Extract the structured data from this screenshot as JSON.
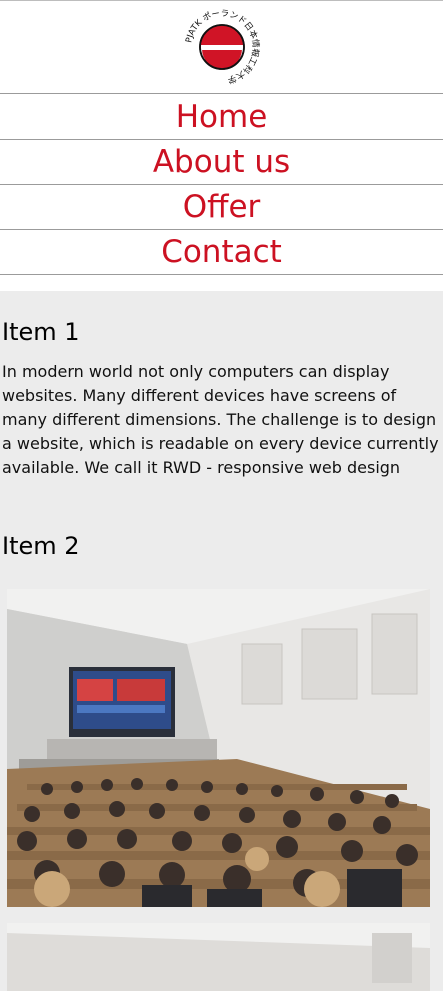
{
  "logo": {
    "alt": "PJATK logo",
    "circle_text": "PJATK ポーランド日本情報工科大学",
    "colors": {
      "red": "#d01426",
      "black": "#111111"
    }
  },
  "nav": {
    "items": [
      {
        "label": "Home"
      },
      {
        "label": "About us"
      },
      {
        "label": "Offer"
      },
      {
        "label": "Contact"
      }
    ],
    "color": "#cc1122"
  },
  "items": [
    {
      "title": "Item 1",
      "text": "In modern world not only computers can display websites. Many different devices have screens of many different dimensions. The challenge is to design a website, which is readable on every device currently available. We call it RWD - responsive web design"
    },
    {
      "title": "Item 2",
      "image_alt": "Lecture hall photo"
    }
  ]
}
